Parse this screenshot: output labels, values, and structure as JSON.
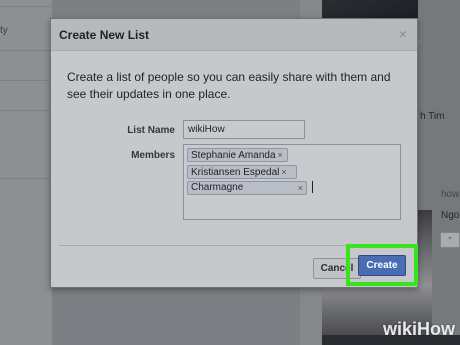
{
  "background": {
    "left_partial_text": "ty",
    "photo_text": "FST",
    "right_text_1": "h Tim",
    "right_text_2": "how",
    "right_text_3": "Ngo",
    "right_button_label": "⁺"
  },
  "dialog": {
    "title": "Create New List",
    "close_icon": "×",
    "description": "Create a list of people so you can easily share with them and see their updates in one place.",
    "list_name_label": "List Name",
    "list_name_value": "wikiHow",
    "members_label": "Members",
    "members": [
      {
        "name": "Stephanie Amanda",
        "remove": "×"
      },
      {
        "name": "Kristiansen Espedal",
        "remove": "×"
      },
      {
        "name": "Charmagne",
        "remove": "×"
      }
    ],
    "cancel_label": "Cancel",
    "create_label": "Create"
  },
  "watermark": {
    "prefix": "wiki",
    "suffix": "How"
  },
  "colors": {
    "create_button": "#4a6cb0",
    "highlight": "#36e31d",
    "overlay": "#7d7f85"
  }
}
